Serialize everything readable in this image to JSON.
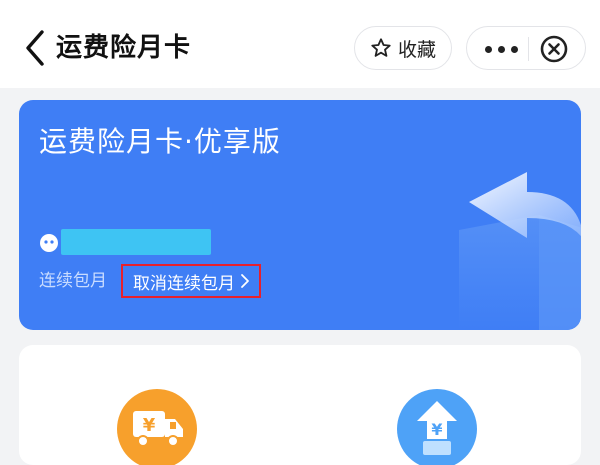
{
  "header": {
    "back_icon": "chevron-left-icon",
    "title": "运费险月卡",
    "favorite_icon": "star-icon",
    "favorite_label": "收藏",
    "more_icon": "more-dots-icon",
    "close_icon": "close-circle-icon"
  },
  "card": {
    "title": "运费险月卡·优享版",
    "renew_label": "连续包月",
    "cancel_label": "取消连续包月",
    "cancel_icon": "chevron-right-icon",
    "colors": {
      "background": "#3f7ef5",
      "user_mask": "#3ec4f3",
      "highlight_border": "#e8202c"
    }
  },
  "features": [
    {
      "icon": "truck-yuan-icon",
      "color": "#f7a02c"
    },
    {
      "icon": "upload-yuan-icon",
      "color": "#4ea2f7"
    }
  ]
}
